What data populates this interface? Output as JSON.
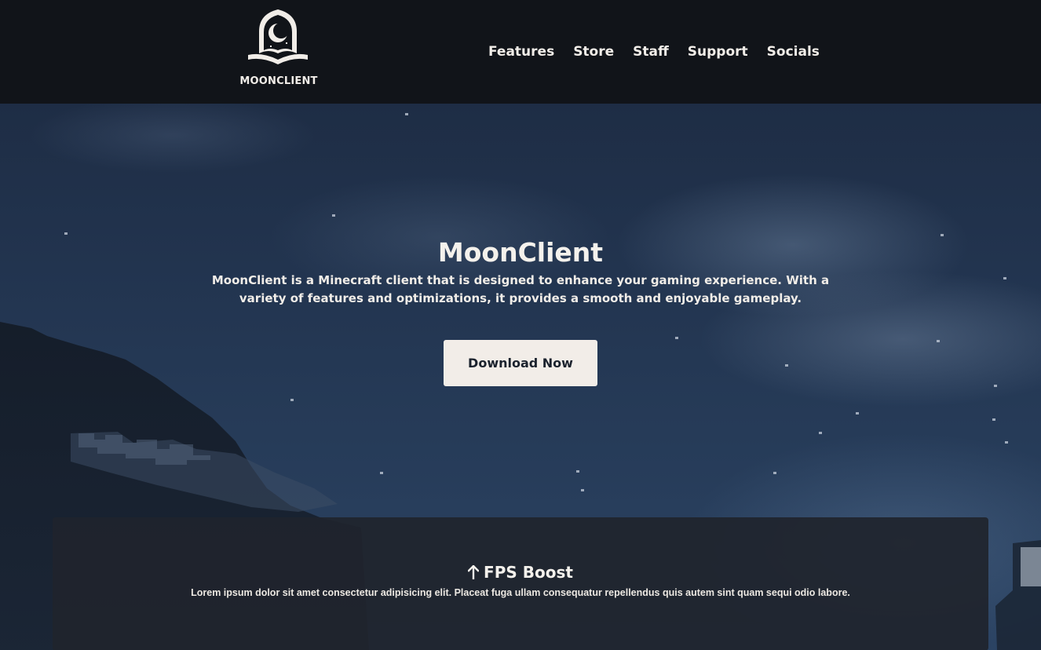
{
  "header": {
    "logo_text": "MOONCLIENT",
    "logo_icon": "moon-book-icon",
    "nav": [
      {
        "label": "Features"
      },
      {
        "label": "Store"
      },
      {
        "label": "Staff"
      },
      {
        "label": "Support"
      },
      {
        "label": "Socials"
      }
    ]
  },
  "hero": {
    "title": "MoonClient",
    "description": "MoonClient is a Minecraft client that is designed to enhance your gaming experience. With a variety of features and optimizations, it provides a smooth and enjoyable gameplay.",
    "download_label": "Download Now"
  },
  "feature": {
    "icon": "arrow-up-icon",
    "title": "FPS Boost",
    "description": "Lorem ipsum dolor sit amet consectetur adipisicing elit. Placeat fuga ullam consequatur repellendus quis autem sint quam sequi odio labore."
  },
  "colors": {
    "header_bg": "#111419",
    "text": "#f1ede8",
    "button_bg": "#f2ede8",
    "button_text": "#1b222d",
    "card_bg": "#20242c",
    "sky": "#22344f"
  }
}
